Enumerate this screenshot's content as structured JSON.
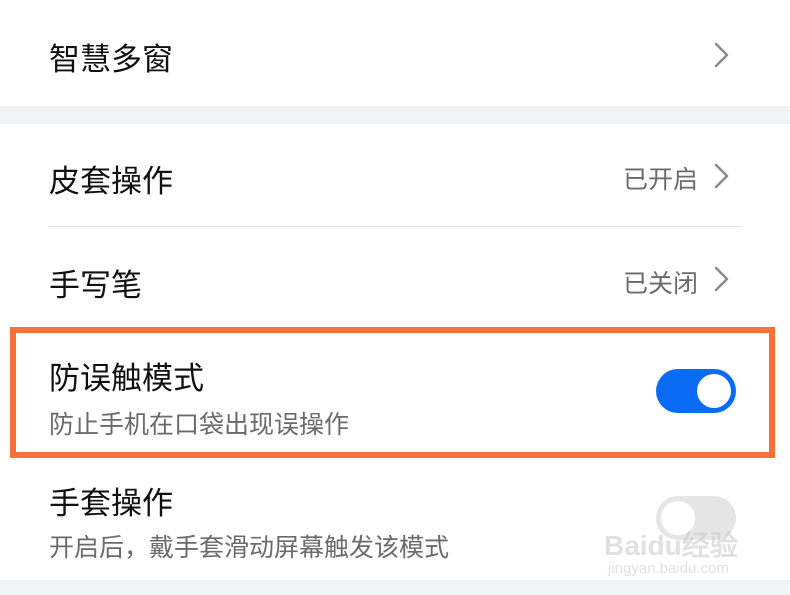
{
  "rows": [
    {
      "title": "智慧多窗",
      "control": "chevron"
    },
    {
      "title": "皮套操作",
      "value": "已开启",
      "control": "chevron"
    },
    {
      "title": "手写笔",
      "value": "已关闭",
      "control": "chevron"
    },
    {
      "title": "防误触模式",
      "subtitle": "防止手机在口袋出现误操作",
      "control": "toggle",
      "toggle_on": true
    },
    {
      "title": "手套操作",
      "subtitle": "开启后，戴手套滑动屏幕触发该模式",
      "control": "toggle",
      "toggle_on": false
    }
  ],
  "colors": {
    "toggle_on": "#0a6cf5",
    "highlight": "#f5703a",
    "background": "#f1f3f5"
  },
  "watermark": {
    "brand": "Baidu经验",
    "url": "jingyan.baidu.com"
  }
}
